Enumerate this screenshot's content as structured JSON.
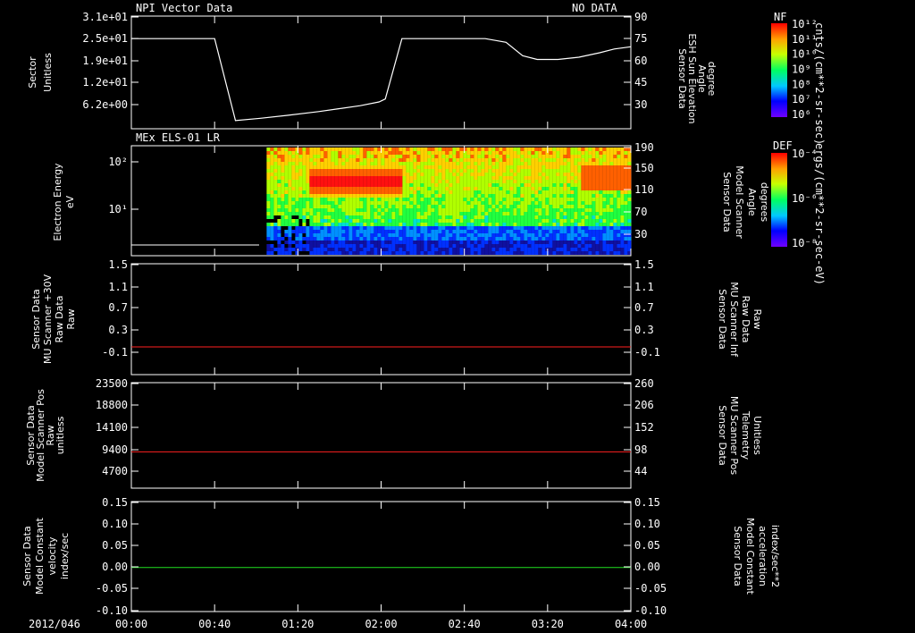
{
  "colors": {
    "background": "#000000",
    "axes": "#ffffff",
    "red": "#ff2020",
    "green": "#20e020"
  },
  "chart_data": [
    {
      "type": "line",
      "title": "NPI Vector Data",
      "status": "NO DATA",
      "left_axis": {
        "label_lines": [
          "Sector",
          "Unitless"
        ],
        "ticks": [
          "3.1e+01",
          "2.5e+01",
          "1.9e+01",
          "1.2e+01",
          "6.2e+00"
        ]
      },
      "right_axis": {
        "label_lines": [
          "Sensor Data",
          "ESH Sun Elevation",
          "Angle",
          "degree"
        ],
        "ticks": [
          "90",
          "75",
          "60",
          "45",
          "30"
        ],
        "ylim": [
          15,
          90
        ]
      },
      "series": [
        {
          "x": [
            0,
            28,
            34,
            39,
            44,
            60,
            80,
            100,
            112,
            118,
            122,
            128,
            136,
            139,
            145,
            150,
            158,
            170,
            190,
            210,
            240
          ],
          "y": [
            75.5,
            75.5,
            70,
            40,
            21,
            23,
            26,
            29,
            31.5,
            34,
            35,
            36,
            75.5,
            75.5,
            75.5,
            75.5,
            75.5,
            75.5,
            75.5,
            75.5,
            75.5
          ],
          "note_unused": ""
        }
      ],
      "curve": {
        "x": [
          0,
          40,
          50,
          62,
          75,
          90,
          100,
          110,
          119,
          122,
          130,
          150,
          170,
          180,
          188,
          195,
          205,
          215,
          225,
          232,
          240
        ],
        "y": [
          75.5,
          75.5,
          20.5,
          22,
          24,
          26.5,
          28.5,
          30.5,
          33,
          35,
          75.5,
          75.5,
          75.5,
          73,
          64,
          61.5,
          61.5,
          63,
          66,
          68.5,
          70
        ]
      }
    },
    {
      "type": "heatmap",
      "title": "MEx ELS-01 LR",
      "left_axis": {
        "label_lines": [
          "Electron Energy",
          "eV"
        ],
        "ticks": [
          "10²",
          "10¹"
        ]
      },
      "right_axis": {
        "label_lines": [
          "Sensor Data",
          "Model Scanner",
          "Angle",
          "degrees"
        ],
        "ticks": [
          "190",
          "150",
          "110",
          "70",
          "30"
        ]
      },
      "colorbar": {
        "label": "DEF",
        "unit": "ergs/(cm**2-sr-sec-eV)",
        "ticks": [
          "10⁻⁴",
          "10⁻⁶",
          "10⁻⁸"
        ]
      },
      "data_start_minute": 65
    },
    {
      "type": "line",
      "left_axis": {
        "label_lines": [
          "Sensor Data",
          "MU Scanner +30V",
          "Raw Data",
          "Raw"
        ],
        "ticks": [
          "1.5",
          "1.1",
          "0.7",
          "0.3",
          "-0.1"
        ],
        "ylim": [
          -0.5,
          1.5
        ]
      },
      "right_axis": {
        "label_lines": [
          "Sensor Data",
          "MU Scanner Inf",
          "Raw Data",
          "Raw"
        ],
        "ticks": [
          "1.5",
          "1.1",
          "0.7",
          "0.3",
          "-0.1"
        ]
      },
      "series": [
        {
          "x": [
            0,
            240
          ],
          "y": [
            0.0,
            0.0
          ]
        }
      ]
    },
    {
      "type": "line",
      "left_axis": {
        "label_lines": [
          "Sensor Data",
          "Model Scanner Pos",
          "Raw",
          "unitless"
        ],
        "ticks": [
          "23500",
          "18800",
          "14100",
          "9400",
          "4700"
        ],
        "ylim": [
          0,
          23500
        ]
      },
      "right_axis": {
        "label_lines": [
          "Sensor Data",
          "MU Scanner Pos",
          "Telemetry",
          "Unitless"
        ],
        "ticks": [
          "260",
          "206",
          "152",
          "98",
          "44"
        ]
      },
      "series": [
        {
          "x": [
            0,
            240
          ],
          "y": [
            8100,
            8100
          ]
        }
      ]
    },
    {
      "type": "line",
      "left_axis": {
        "label_lines": [
          "Sensor Data",
          "Model Constant",
          "velocity",
          "index/sec"
        ],
        "ticks": [
          "0.15",
          "0.10",
          "0.05",
          "0.00",
          "-0.05",
          "-0.10"
        ],
        "ylim": [
          -0.1,
          0.15
        ]
      },
      "right_axis": {
        "label_lines": [
          "Sensor Data",
          "Model Constant",
          "acceleration",
          "index/sec**2"
        ],
        "ticks": [
          "0.15",
          "0.10",
          "0.05",
          "0.00",
          "-0.05",
          "-0.10"
        ]
      },
      "series": [
        {
          "x": [
            0,
            240
          ],
          "y": [
            0.0,
            0.0
          ]
        }
      ]
    }
  ],
  "top_colorbar": {
    "label": "NF",
    "unit": "cnts/(cm**2-sr-sec)",
    "ticks": [
      "10¹²",
      "10¹¹",
      "10¹⁰",
      "10⁹",
      "10⁸",
      "10⁷",
      "10⁶"
    ]
  },
  "time_axis": {
    "date": "2012/046",
    "ticks": [
      "00:00",
      "00:40",
      "01:20",
      "02:00",
      "02:40",
      "03:20",
      "04:00"
    ],
    "xlim_minutes": [
      0,
      240
    ]
  }
}
